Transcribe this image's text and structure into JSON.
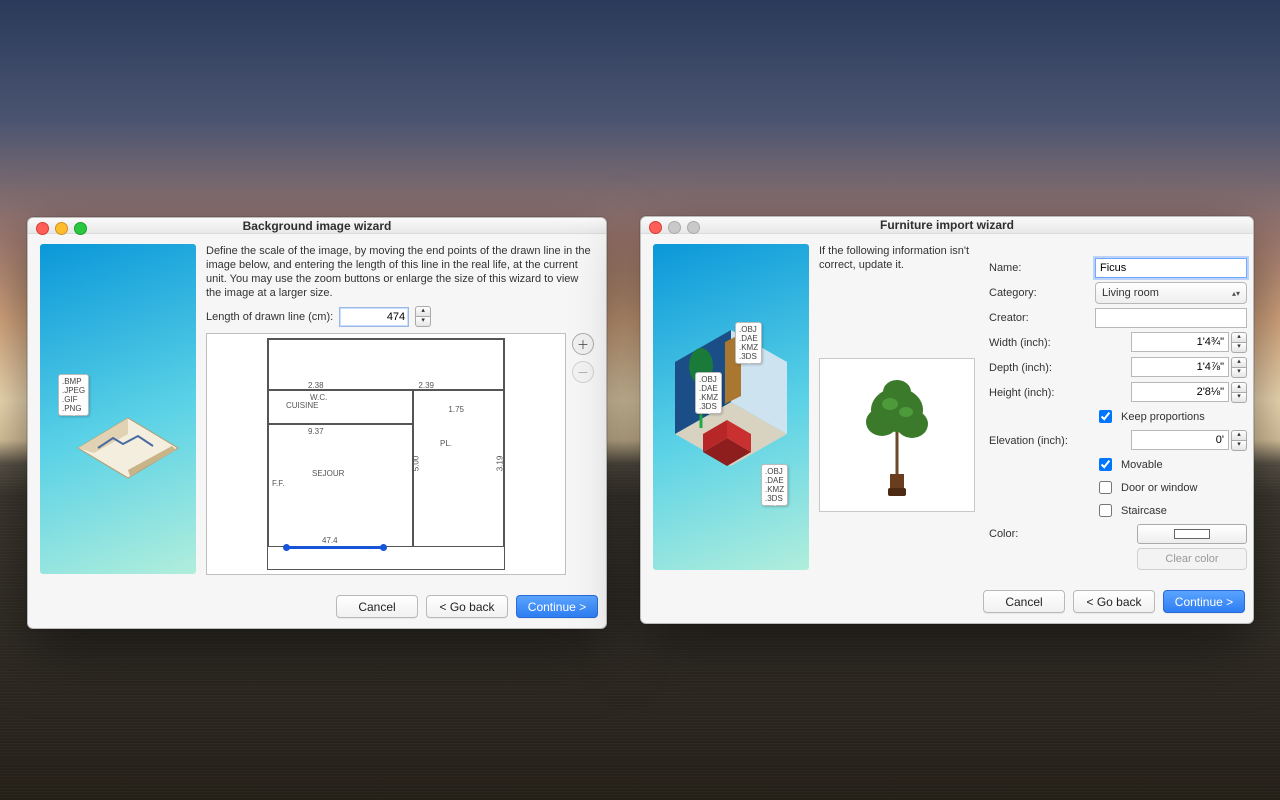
{
  "left": {
    "title": "Background image wizard",
    "instructions": "Define the scale of the image, by moving the end points of the drawn line in the image below, and entering the length of this line in the real life, at the current unit. You may use the zoom buttons or enlarge the size of this wizard to view the image at a larger size.",
    "length_label": "Length of drawn line (cm):",
    "length_value": "474",
    "filetag": ".BMP\n.JPEG\n.GIF\n.PNG",
    "plan": {
      "cuisine": "CUISINE",
      "sejour": "SEJOUR",
      "wc": "W.C.",
      "pl": "PL.",
      "m474": "47.4",
      "m93": "9.37",
      "m23a": "2.38",
      "m23b": "2.39",
      "m500": "5.00",
      "m319": "3.19",
      "m175": "1.75",
      "ff": "F.F."
    },
    "buttons": {
      "cancel": "Cancel",
      "back": "< Go back",
      "cont": "Continue >"
    }
  },
  "right": {
    "title": "Furniture import wizard",
    "instructions": "If the following information isn't correct, update it.",
    "filetag1": ".OBJ\n.DAE\n.KMZ\n.3DS",
    "filetag2": ".OBJ\n.DAE\n.KMZ\n.3DS",
    "filetag3": ".OBJ\n.DAE\n.KMZ\n.3DS",
    "labels": {
      "name": "Name:",
      "category": "Category:",
      "creator": "Creator:",
      "width": "Width (inch):",
      "depth": "Depth (inch):",
      "height": "Height (inch):",
      "keep": "Keep proportions",
      "elevation": "Elevation (inch):",
      "movable": "Movable",
      "door": "Door or window",
      "stair": "Staircase",
      "color": "Color:",
      "clear": "Clear color"
    },
    "values": {
      "name": "Ficus",
      "category": "Living room",
      "creator": "",
      "width": "1'4¾\"",
      "depth": "1'4⅞\"",
      "height": "2'8⅛\"",
      "elevation": "0'"
    },
    "buttons": {
      "cancel": "Cancel",
      "back": "< Go back",
      "cont": "Continue >"
    }
  }
}
